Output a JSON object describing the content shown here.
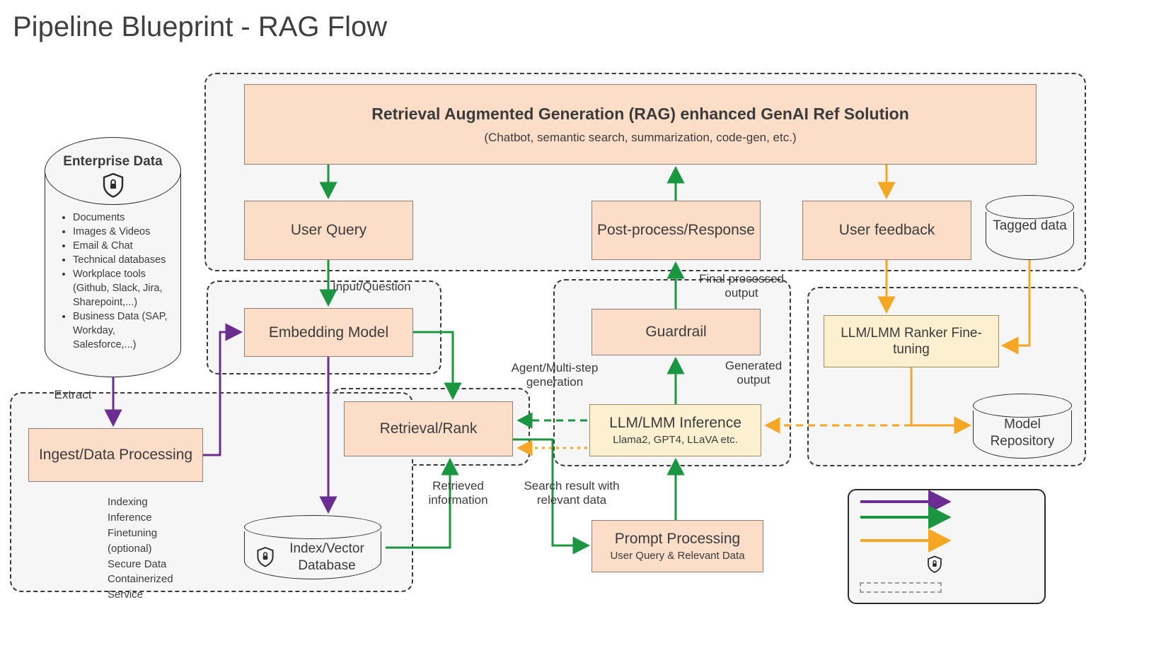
{
  "title": "Pipeline Blueprint - RAG Flow",
  "colors": {
    "indexing": "#6b2d91",
    "inference": "#1a9641",
    "finetuning": "#f5a623",
    "box_fill": "#fbddc8",
    "box_fill_yellow": "#fdf0d0",
    "box_border": "#8d7f78",
    "group_fill": "#f6f6f6",
    "group_border": "#3a3a3a",
    "text": "#3b3b3b"
  },
  "enterprise": {
    "title": "Enterprise Data",
    "icon": "shield-lock-icon",
    "items": [
      "Documents",
      "Images & Videos",
      "Email & Chat",
      "Technical databases",
      "Workplace tools (Github, Slack, Jira, Sharepoint,...)",
      "Business Data (SAP, Workday, Salesforce,...)"
    ]
  },
  "boxes": {
    "rag_solution": {
      "title": "Retrieval Augmented Generation (RAG) enhanced GenAI Ref Solution",
      "subtitle": "(Chatbot, semantic search, summarization, code-gen, etc.)"
    },
    "user_query": "User Query",
    "post_process": "Post-process/Response",
    "user_feedback": "User feedback",
    "embedding_model": "Embedding Model",
    "guardrail": "Guardrail",
    "llm_ranker_finetuning": "LLM/LMM Ranker Fine-tuning",
    "retrieval_rank": "Retrieval/Rank",
    "llm_inference": {
      "title": "LLM/LMM Inference",
      "subtitle": "Llama2, GPT4, LLaVA etc."
    },
    "ingest": "Ingest/Data Processing",
    "prompt_processing": {
      "title": "Prompt Processing",
      "subtitle": "User Query & Relevant Data"
    }
  },
  "cylinders": {
    "tagged_data": "Tagged data",
    "model_repository": "Model Repository",
    "index_vector_db": "Index/Vector Database"
  },
  "edge_labels": {
    "extract": "Extract",
    "input_question": "Input/Question",
    "final_processed_output": "Final processed output",
    "generated_output": "Generated output",
    "agent_multistep": "Agent/Multi-step generation",
    "retrieved_information": "Retrieved information",
    "search_result": "Search result with relevant data"
  },
  "legend": {
    "items": [
      {
        "label": "Indexing",
        "kind": "arrow",
        "color": "#6b2d91"
      },
      {
        "label": "Inference",
        "kind": "arrow",
        "color": "#1a9641"
      },
      {
        "label": "Finetuning (optional)",
        "kind": "arrow",
        "color": "#f5a623"
      },
      {
        "label": "Secure Data",
        "kind": "shield-lock-icon"
      },
      {
        "label": "Containerized Service",
        "kind": "dashed-box-icon"
      }
    ],
    "lines": [
      "Indexing",
      "Inference",
      "Finetuning",
      "(optional)",
      "Secure Data",
      "Containerized",
      "Service"
    ]
  }
}
